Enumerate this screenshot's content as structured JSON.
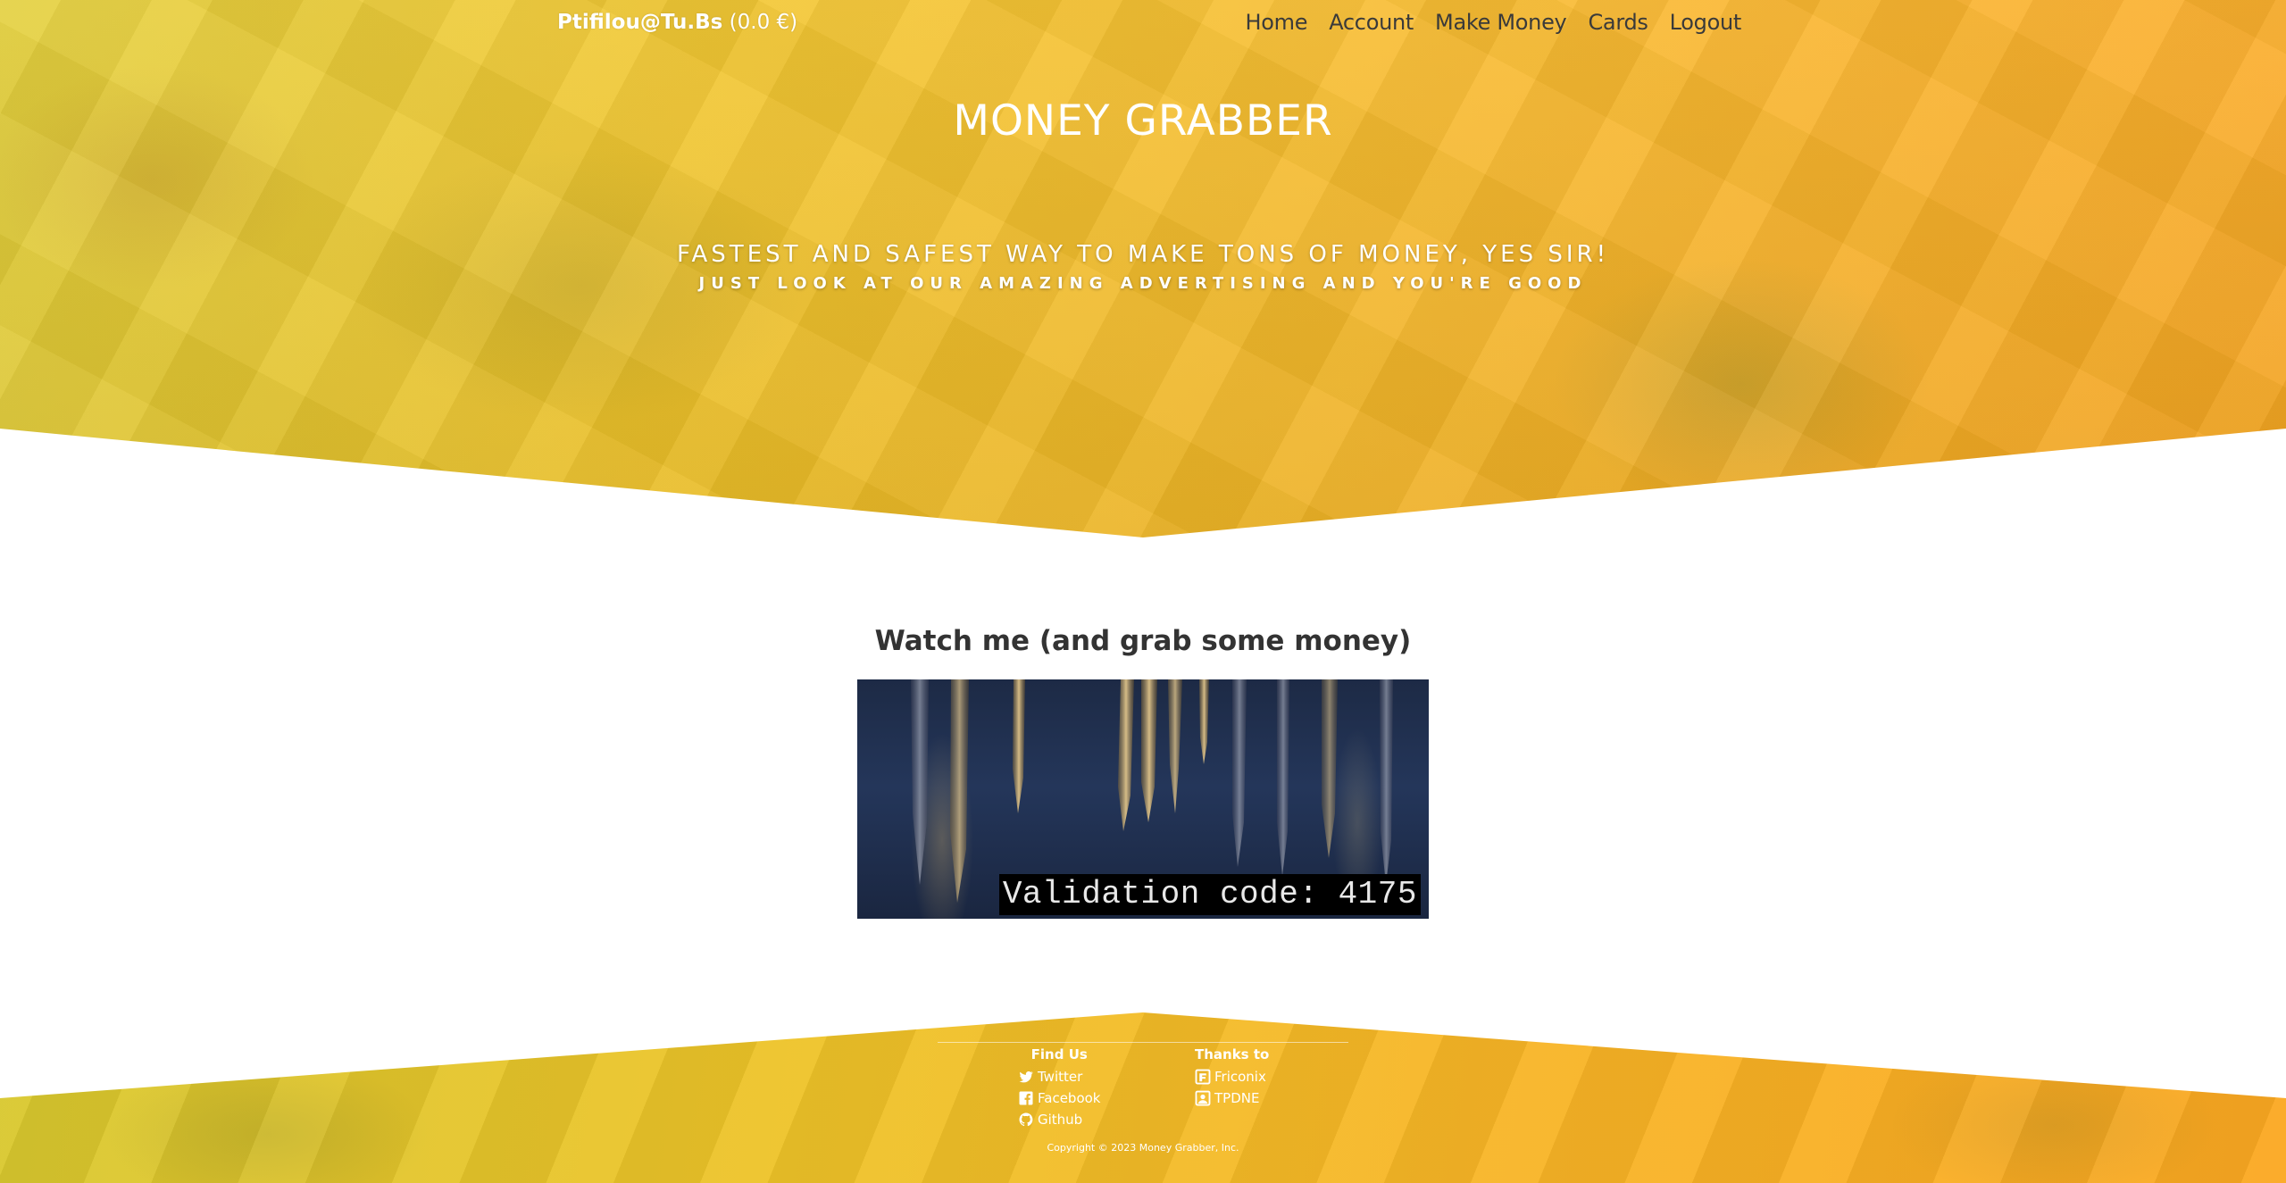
{
  "navbar": {
    "brand_user": "Ptifilou@Tu.Bs",
    "brand_balance": "(0.0 €)",
    "links": [
      {
        "label": "Home"
      },
      {
        "label": "Account"
      },
      {
        "label": "Make Money"
      },
      {
        "label": "Cards"
      },
      {
        "label": "Logout"
      }
    ]
  },
  "hero": {
    "title": "MONEY GRABBER",
    "tagline": "FASTEST AND SAFEST WAY TO MAKE TONS OF MONEY, YES SIR!",
    "subtagline": "JUST LOOK AT OUR AMAZING ADVERTISING AND YOU'RE GOOD"
  },
  "main": {
    "heading": "Watch me (and grab some money)",
    "video": {
      "overlay_text": "Validation code: 4175"
    }
  },
  "footer": {
    "find_us": {
      "title": "Find Us",
      "links": [
        {
          "label": "Twitter",
          "icon": "twitter-icon"
        },
        {
          "label": "Facebook",
          "icon": "facebook-icon"
        },
        {
          "label": "Github",
          "icon": "github-icon"
        }
      ]
    },
    "thanks_to": {
      "title": "Thanks to",
      "links": [
        {
          "label": "Friconix",
          "icon": "friconix-icon"
        },
        {
          "label": "TPDNE",
          "icon": "tpdne-icon"
        }
      ]
    },
    "copyright": "Copyright © 2023 Money Grabber, Inc."
  },
  "colors": {
    "hero_gradient_start": "#e3cf38",
    "hero_gradient_end": "#fba822",
    "nav_link": "#3a3a3a",
    "heading": "#333333"
  }
}
